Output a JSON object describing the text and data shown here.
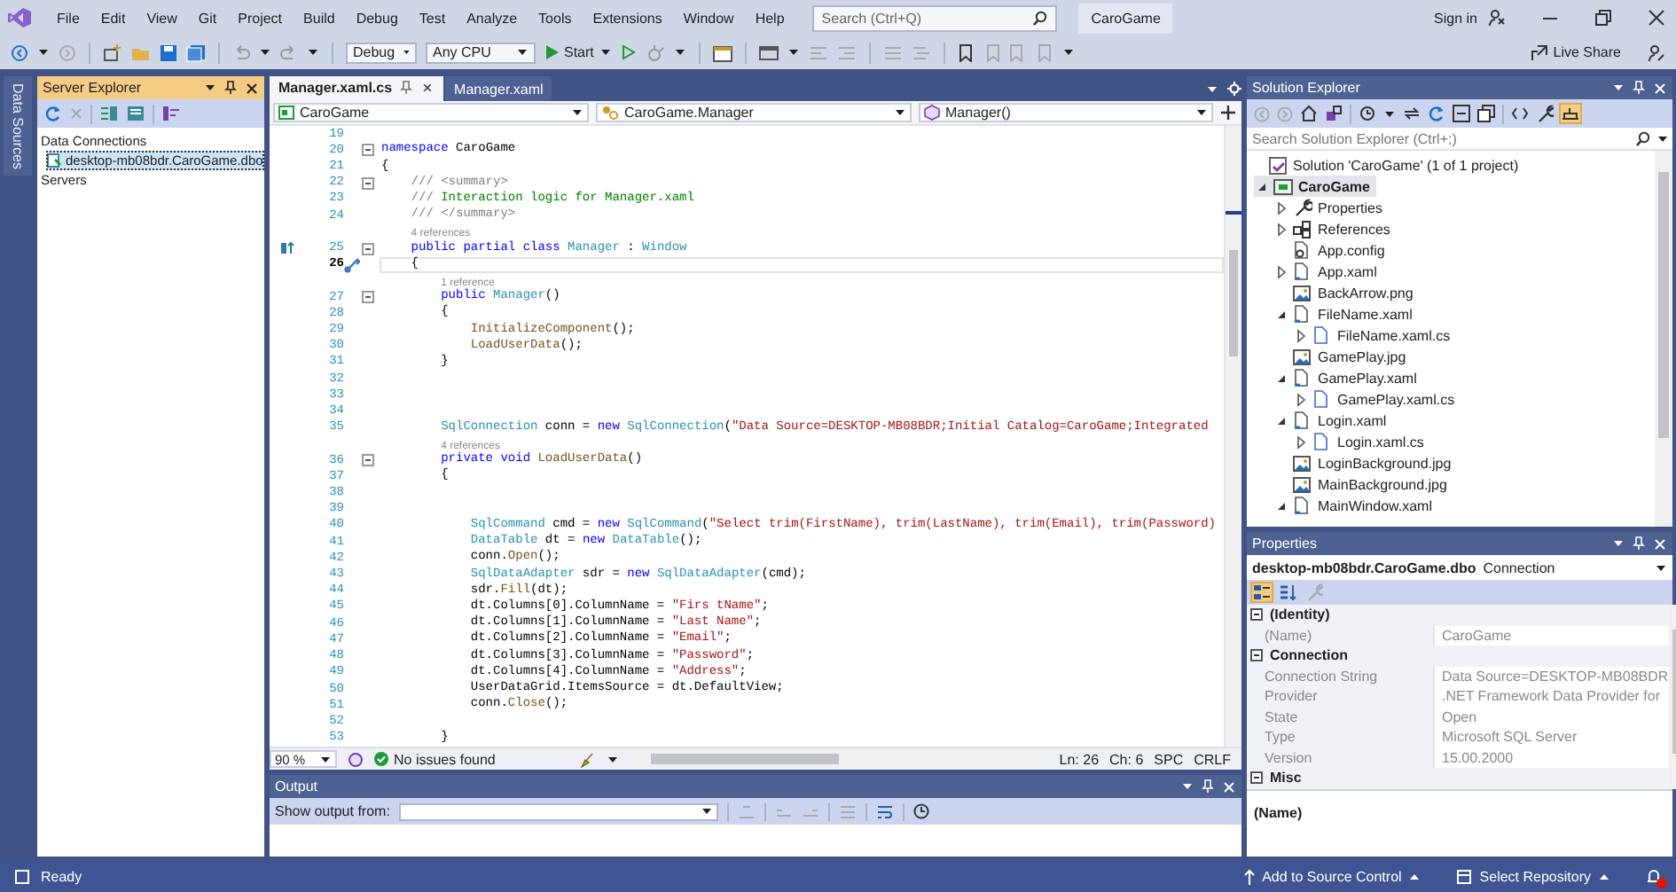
{
  "menu_bar": {
    "items": [
      "File",
      "Edit",
      "View",
      "Git",
      "Project",
      "Build",
      "Debug",
      "Test",
      "Analyze",
      "Tools",
      "Extensions",
      "Window",
      "Help"
    ],
    "search": {
      "placeholder": "Search (Ctrl+Q)"
    },
    "solution_name": "CaroGame",
    "sign_in": "Sign in"
  },
  "toolbar": {
    "configuration": "Debug",
    "platform": "Any CPU",
    "start": "Start",
    "live_share": "Live Share"
  },
  "side_tabs": [
    "Data Sources"
  ],
  "server_explorer": {
    "title": "Server Explorer",
    "active": true,
    "tree": [
      {
        "label": "Data Connections",
        "selected": false,
        "children": [
          {
            "label": "desktop-mb08bdr.CaroGame.dbo",
            "selected": true
          }
        ]
      },
      {
        "label": "Servers",
        "selected": false
      }
    ]
  },
  "editor": {
    "tabs": [
      {
        "label": "Manager.xaml.cs",
        "selected": true
      },
      {
        "label": "Manager.xaml",
        "selected": false
      }
    ],
    "navigation": [
      "CaroGame",
      "CaroGame.Manager",
      "Manager()"
    ],
    "lines": [
      {
        "kind": "code",
        "number": "19",
        "current": false,
        "fold": false
      },
      {
        "kind": "code",
        "number": "20",
        "current": false,
        "fold": true,
        "tokens": [
          {
            "text": "namespace ",
            "kind": "kw"
          },
          {
            "text": "CaroGame",
            "kind": "plain"
          }
        ]
      },
      {
        "kind": "code",
        "number": "21",
        "current": false,
        "fold": false,
        "tokens": [
          {
            "text": "{",
            "kind": "plain"
          }
        ]
      },
      {
        "kind": "code",
        "number": "22",
        "current": false,
        "fold": true,
        "tokens": [
          {
            "text": "    /// <summary>",
            "kind": "doc"
          }
        ]
      },
      {
        "kind": "code",
        "number": "23",
        "current": false,
        "fold": false,
        "tokens": [
          {
            "text": "    /// ",
            "kind": "doc"
          },
          {
            "text": "Interaction logic for Manager.xaml",
            "kind": "com"
          }
        ]
      },
      {
        "kind": "code",
        "number": "24",
        "current": false,
        "fold": false,
        "tokens": [
          {
            "text": "    /// </summary>",
            "kind": "doc"
          }
        ]
      },
      {
        "kind": "lens",
        "text": "4 references"
      },
      {
        "kind": "code",
        "number": "25",
        "current": false,
        "fold": true,
        "inherits": true,
        "tokens": [
          {
            "text": "    public partial class ",
            "kind": "kw"
          },
          {
            "text": "Manager",
            "kind": "type"
          },
          {
            "text": " : ",
            "kind": "plain"
          },
          {
            "text": "Window",
            "kind": "type"
          }
        ]
      },
      {
        "kind": "code",
        "number": "26",
        "current": true,
        "fold": false,
        "quick_action": true,
        "tokens": [
          {
            "text": "    {",
            "kind": "plain"
          }
        ]
      },
      {
        "kind": "lens",
        "text": "1 reference"
      },
      {
        "kind": "code",
        "number": "27",
        "current": false,
        "fold": true,
        "tokens": [
          {
            "text": "        public ",
            "kind": "kw"
          },
          {
            "text": "Manager",
            "kind": "type"
          },
          {
            "text": "()",
            "kind": "plain"
          }
        ]
      },
      {
        "kind": "code",
        "number": "28",
        "current": false,
        "fold": false,
        "tokens": [
          {
            "text": "        {",
            "kind": "plain"
          }
        ]
      },
      {
        "kind": "code",
        "number": "29",
        "current": false,
        "fold": false,
        "tokens": [
          {
            "text": "            InitializeComponent",
            "kind": "method"
          },
          {
            "text": "();",
            "kind": "plain"
          }
        ]
      },
      {
        "kind": "code",
        "number": "30",
        "current": false,
        "fold": false,
        "tokens": [
          {
            "text": "            LoadUserData",
            "kind": "method"
          },
          {
            "text": "();",
            "kind": "plain"
          }
        ]
      },
      {
        "kind": "code",
        "number": "31",
        "current": false,
        "fold": false,
        "tokens": [
          {
            "text": "        }",
            "kind": "plain"
          }
        ]
      },
      {
        "kind": "code",
        "number": "32",
        "current": false,
        "fold": false
      },
      {
        "kind": "code",
        "number": "33",
        "current": false,
        "fold": false
      },
      {
        "kind": "code",
        "number": "34",
        "current": false,
        "fold": false
      },
      {
        "kind": "code",
        "number": "35",
        "current": false,
        "fold": false,
        "tokens": [
          {
            "text": "        SqlConnection",
            "kind": "type"
          },
          {
            "text": " conn = ",
            "kind": "plain"
          },
          {
            "text": "new ",
            "kind": "kw"
          },
          {
            "text": "SqlConnection",
            "kind": "type"
          },
          {
            "text": "(",
            "kind": "plain"
          },
          {
            "text": "\"Data Source=DESKTOP-MB08BDR;Initial Catalog=CaroGame;Integrated",
            "kind": "str"
          }
        ]
      },
      {
        "kind": "lens",
        "text": "4 references"
      },
      {
        "kind": "code",
        "number": "36",
        "current": false,
        "fold": true,
        "tokens": [
          {
            "text": "        private void ",
            "kind": "kw"
          },
          {
            "text": "LoadUserData",
            "kind": "method"
          },
          {
            "text": "()",
            "kind": "plain"
          }
        ]
      },
      {
        "kind": "code",
        "number": "37",
        "current": false,
        "fold": false,
        "tokens": [
          {
            "text": "        {",
            "kind": "plain"
          }
        ]
      },
      {
        "kind": "code",
        "number": "38",
        "current": false,
        "fold": false
      },
      {
        "kind": "code",
        "number": "39",
        "current": false,
        "fold": false
      },
      {
        "kind": "code",
        "number": "40",
        "current": false,
        "fold": false,
        "tokens": [
          {
            "text": "            SqlCommand",
            "kind": "type"
          },
          {
            "text": " cmd = ",
            "kind": "plain"
          },
          {
            "text": "new ",
            "kind": "kw"
          },
          {
            "text": "SqlCommand",
            "kind": "type"
          },
          {
            "text": "(",
            "kind": "plain"
          },
          {
            "text": "\"Select trim(FirstName), trim(LastName), trim(Email), trim(Password)",
            "kind": "str"
          }
        ]
      },
      {
        "kind": "code",
        "number": "41",
        "current": false,
        "fold": false,
        "tokens": [
          {
            "text": "            DataTable",
            "kind": "type"
          },
          {
            "text": " dt = ",
            "kind": "plain"
          },
          {
            "text": "new ",
            "kind": "kw"
          },
          {
            "text": "DataTable",
            "kind": "type"
          },
          {
            "text": "();",
            "kind": "plain"
          }
        ]
      },
      {
        "kind": "code",
        "number": "42",
        "current": false,
        "fold": false,
        "tokens": [
          {
            "text": "            conn.",
            "kind": "plain"
          },
          {
            "text": "Open",
            "kind": "method"
          },
          {
            "text": "();",
            "kind": "plain"
          }
        ]
      },
      {
        "kind": "code",
        "number": "43",
        "current": false,
        "fold": false,
        "tokens": [
          {
            "text": "            SqlDataAdapter",
            "kind": "type"
          },
          {
            "text": " sdr = ",
            "kind": "plain"
          },
          {
            "text": "new ",
            "kind": "kw"
          },
          {
            "text": "SqlDataAdapter",
            "kind": "type"
          },
          {
            "text": "(cmd);",
            "kind": "plain"
          }
        ]
      },
      {
        "kind": "code",
        "number": "44",
        "current": false,
        "fold": false,
        "tokens": [
          {
            "text": "            sdr.",
            "kind": "plain"
          },
          {
            "text": "Fill",
            "kind": "method"
          },
          {
            "text": "(dt);",
            "kind": "plain"
          }
        ]
      },
      {
        "kind": "code",
        "number": "45",
        "current": false,
        "fold": false,
        "tokens": [
          {
            "text": "            dt.Columns[0].ColumnName = ",
            "kind": "plain"
          },
          {
            "text": "\"Firs tName\"",
            "kind": "str"
          },
          {
            "text": ";",
            "kind": "plain"
          }
        ]
      },
      {
        "kind": "code",
        "number": "46",
        "current": false,
        "fold": false,
        "tokens": [
          {
            "text": "            dt.Columns[1].ColumnName = ",
            "kind": "plain"
          },
          {
            "text": "\"Last Name\"",
            "kind": "str"
          },
          {
            "text": ";",
            "kind": "plain"
          }
        ]
      },
      {
        "kind": "code",
        "number": "47",
        "current": false,
        "fold": false,
        "tokens": [
          {
            "text": "            dt.Columns[2].ColumnName = ",
            "kind": "plain"
          },
          {
            "text": "\"Email\"",
            "kind": "str"
          },
          {
            "text": ";",
            "kind": "plain"
          }
        ]
      },
      {
        "kind": "code",
        "number": "48",
        "current": false,
        "fold": false,
        "tokens": [
          {
            "text": "            dt.Columns[3].ColumnName = ",
            "kind": "plain"
          },
          {
            "text": "\"Password\"",
            "kind": "str"
          },
          {
            "text": ";",
            "kind": "plain"
          }
        ]
      },
      {
        "kind": "code",
        "number": "49",
        "current": false,
        "fold": false,
        "tokens": [
          {
            "text": "            dt.Columns[4].ColumnName = ",
            "kind": "plain"
          },
          {
            "text": "\"Address\"",
            "kind": "str"
          },
          {
            "text": ";",
            "kind": "plain"
          }
        ]
      },
      {
        "kind": "code",
        "number": "50",
        "current": false,
        "fold": false,
        "tokens": [
          {
            "text": "            UserDataGrid.ItemsSource = dt.DefaultView;",
            "kind": "plain"
          }
        ]
      },
      {
        "kind": "code",
        "number": "51",
        "current": false,
        "fold": false,
        "tokens": [
          {
            "text": "            conn.",
            "kind": "plain"
          },
          {
            "text": "Close",
            "kind": "method"
          },
          {
            "text": "();",
            "kind": "plain"
          }
        ]
      },
      {
        "kind": "code",
        "number": "52",
        "current": false,
        "fold": false
      },
      {
        "kind": "code",
        "number": "53",
        "current": false,
        "fold": false,
        "tokens": [
          {
            "text": "        }",
            "kind": "plain"
          }
        ]
      }
    ],
    "zoom": "90 %",
    "issues": "No issues found",
    "line_position": "Ln: 26",
    "column_position": "Ch: 6",
    "whitespace": "SPC",
    "line_ending": "CRLF"
  },
  "output": {
    "title": "Output",
    "source_label": "Show output from:"
  },
  "solution_explorer": {
    "title": "Solution Explorer",
    "search": {
      "placeholder": "Search Solution Explorer (Ctrl+;)"
    },
    "tree": [
      {
        "label": "Solution 'CaroGame' (1 of 1 project)",
        "kind": "solution",
        "selected": false,
        "children": [
          {
            "label": "CaroGame",
            "kind": "project",
            "expanded": true,
            "selected": true,
            "children": [
              {
                "label": "Properties",
                "kind": "properties",
                "expanded": false,
                "selected": false
              },
              {
                "label": "References",
                "kind": "references",
                "expanded": false,
                "selected": false
              },
              {
                "label": "App.config",
                "kind": "config",
                "selected": false
              },
              {
                "label": "App.xaml",
                "kind": "xaml",
                "expanded": false,
                "selected": false
              },
              {
                "label": "BackArrow.png",
                "kind": "image",
                "selected": false
              },
              {
                "label": "FileName.xaml",
                "kind": "xaml",
                "expanded": true,
                "selected": false,
                "children": [
                  {
                    "label": "FileName.xaml.cs",
                    "kind": "cs",
                    "expanded": false,
                    "selected": false
                  }
                ]
              },
              {
                "label": "GamePlay.jpg",
                "kind": "image",
                "selected": false
              },
              {
                "label": "GamePlay.xaml",
                "kind": "xaml",
                "expanded": true,
                "selected": false,
                "children": [
                  {
                    "label": "GamePlay.xaml.cs",
                    "kind": "cs",
                    "expanded": false,
                    "selected": false
                  }
                ]
              },
              {
                "label": "Login.xaml",
                "kind": "xaml",
                "expanded": true,
                "selected": false,
                "children": [
                  {
                    "label": "Login.xaml.cs",
                    "kind": "cs",
                    "expanded": false,
                    "selected": false
                  }
                ]
              },
              {
                "label": "LoginBackground.jpg",
                "kind": "image",
                "selected": false
              },
              {
                "label": "MainBackground.jpg",
                "kind": "image",
                "selected": false
              },
              {
                "label": "MainWindow.xaml",
                "kind": "xaml",
                "expanded": true,
                "selected": false
              }
            ]
          }
        ]
      }
    ]
  },
  "properties": {
    "title": "Properties",
    "object_name": "desktop-mb08bdr.CaroGame.dbo",
    "object_type": "Connection",
    "categories": [
      {
        "name": "(Identity)",
        "expanded": true,
        "rows": [
          {
            "name": "(Name)",
            "value": "CaroGame"
          }
        ]
      },
      {
        "name": "Connection",
        "expanded": true,
        "rows": [
          {
            "name": "Connection String",
            "value": "Data Source=DESKTOP-MB08BDR"
          },
          {
            "name": "Provider",
            "value": ".NET Framework Data Provider for"
          },
          {
            "name": "State",
            "value": "Open"
          },
          {
            "name": "Type",
            "value": "Microsoft SQL Server"
          },
          {
            "name": "Version",
            "value": "15.00.2000"
          }
        ]
      },
      {
        "name": "Misc",
        "expanded": true
      }
    ],
    "description_title": "(Name)"
  },
  "status_bar": {
    "text": "Ready",
    "source_control": "Add to Source Control",
    "repository": "Select Repository"
  }
}
